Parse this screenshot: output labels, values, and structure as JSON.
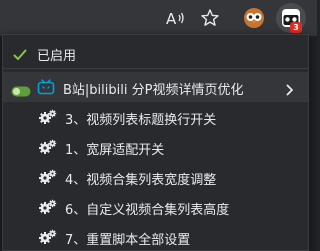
{
  "toolbar": {
    "reader_mode_icon": "read-aloud-icon",
    "bookmark_icon": "star-icon",
    "extension1_icon": "owl-extension-icon",
    "extension2_icon": "tampermonkey-icon",
    "badge_count": "3"
  },
  "menu": {
    "enabled_label": "已启用",
    "script": {
      "name": "B站|bilibili 分P视频详情页优化",
      "toggle_on": true
    },
    "commands": [
      {
        "label": "3、视频列表标题换行开关"
      },
      {
        "label": "1、宽屏适配开关"
      },
      {
        "label": "4、视频合集列表宽度调整"
      },
      {
        "label": "6、自定义视频合集列表高度"
      },
      {
        "label": "7、重置脚本全部设置"
      }
    ]
  },
  "colors": {
    "accent_green": "#8bc34a",
    "toggle_green": "#5f9e3a",
    "bili_blue": "#00a1d6",
    "badge_red": "#d93025"
  }
}
